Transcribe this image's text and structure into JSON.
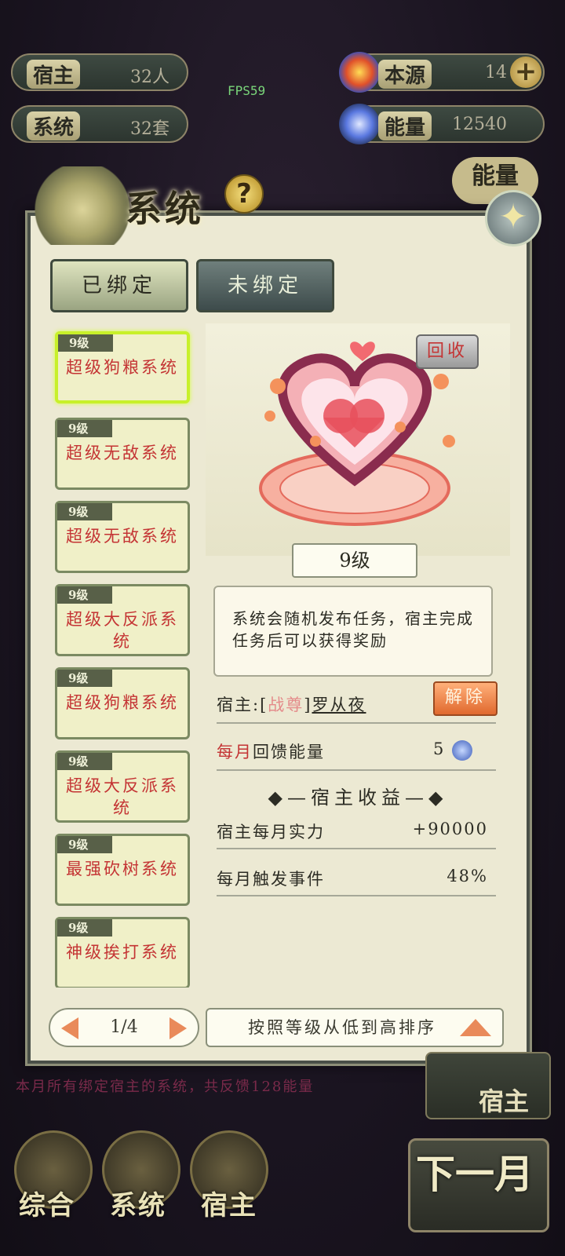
{
  "hud": {
    "host_label": "宿主",
    "host_value": "32人",
    "system_label": "系统",
    "system_value": "32套",
    "source_label": "本源",
    "source_value": "14",
    "energy_label": "能量",
    "energy_value": "12540",
    "fps": "FPS59",
    "energy_side_label": "能量"
  },
  "panel": {
    "title": "系统",
    "tabs": [
      "已绑定",
      "未绑定"
    ]
  },
  "systems": [
    {
      "level": "9级",
      "name": "超级狗粮系统",
      "selected": true
    },
    {
      "level": "9级",
      "name": "超级无敌系统",
      "selected": false
    },
    {
      "level": "9级",
      "name": "超级无敌系统",
      "selected": false
    },
    {
      "level": "9级",
      "name": "超级大反派系统",
      "selected": false
    },
    {
      "level": "9级",
      "name": "超级狗粮系统",
      "selected": false
    },
    {
      "level": "9级",
      "name": "超级大反派系统",
      "selected": false
    },
    {
      "level": "9级",
      "name": "最强砍树系统",
      "selected": false
    },
    {
      "level": "9级",
      "name": "神级挨打系统",
      "selected": false
    }
  ],
  "detail": {
    "recycle_label": "回收",
    "level": "9级",
    "description": "系统会随机发布任务，宿主完成任务后可以获得奖励",
    "host_prefix": "宿主:[",
    "host_rank": "战尊",
    "host_suffix": "]",
    "host_name": "罗从夜",
    "unbind_label": "解除",
    "monthly_prefix": "每月",
    "monthly_label": "回馈能量",
    "monthly_value": "5",
    "section_title": "宿主收益",
    "stats": [
      {
        "label": "宿主每月实力",
        "value": "+90000"
      },
      {
        "label": "每月触发事件",
        "value": "48%"
      }
    ]
  },
  "footer": {
    "page": "1/4",
    "sort_label": "按照等级从低到高排序"
  },
  "bottom": {
    "note": "本月所有绑定宿主的系统，共反馈128能量",
    "nav": [
      "综合",
      "系统",
      "宿主"
    ],
    "next_label": "下一月",
    "find_label": "宿主"
  },
  "colors": {
    "accent_red": "#c43434",
    "selected_border": "#c8f02a",
    "button_orange": "#e0692e"
  }
}
